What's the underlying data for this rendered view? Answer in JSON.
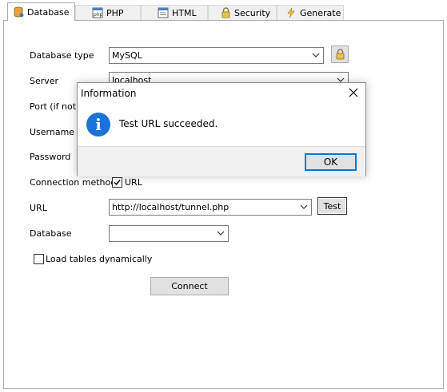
{
  "tabs": [
    {
      "label": "Database",
      "icon": "database-icon",
      "active": true
    },
    {
      "label": "PHP",
      "icon": "php-icon",
      "active": false
    },
    {
      "label": "HTML",
      "icon": "html-icon",
      "active": false
    },
    {
      "label": "Security",
      "icon": "lock-icon",
      "active": false
    },
    {
      "label": "Generate",
      "icon": "lightning-icon",
      "active": false
    }
  ],
  "form": {
    "database_type": {
      "label": "Database type",
      "value": "MySQL"
    },
    "server": {
      "label": "Server",
      "value": "localhost"
    },
    "port": {
      "label": "Port (if not d"
    },
    "username": {
      "label": "Username"
    },
    "password": {
      "label": "Password"
    },
    "connection_method": {
      "label": "Connection method",
      "checkbox_label": "URL",
      "checked": true
    },
    "url": {
      "label": "URL",
      "value": "http://localhost/tunnel.php",
      "test_label": "Test"
    },
    "database": {
      "label": "Database",
      "value": ""
    },
    "load_tables": {
      "label": "Load tables dynamically",
      "checked": false
    },
    "connect_label": "Connect"
  },
  "dialog": {
    "title": "Information",
    "message": "Test URL succeeded.",
    "ok_label": "OK",
    "icon": "info-icon"
  },
  "colors": {
    "accent": "#0078d7",
    "info": "#1a73d9"
  }
}
